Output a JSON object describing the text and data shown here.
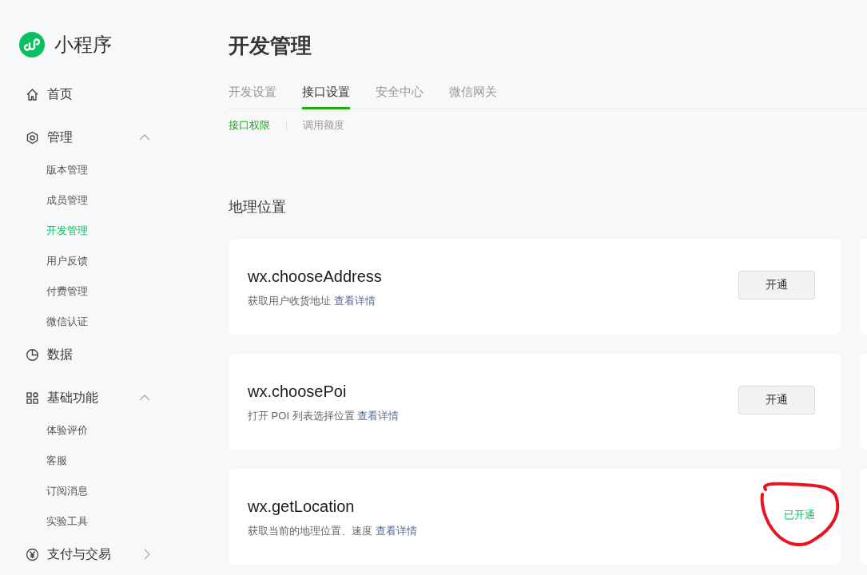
{
  "sidebar": {
    "logo_text": "小程序",
    "items": [
      {
        "label": "首页",
        "kind": "link"
      },
      {
        "label": "管理",
        "kind": "group",
        "expanded": true,
        "children": [
          {
            "label": "版本管理",
            "selected": false
          },
          {
            "label": "成员管理",
            "selected": false
          },
          {
            "label": "开发管理",
            "selected": true
          },
          {
            "label": "用户反馈",
            "selected": false
          },
          {
            "label": "付费管理",
            "selected": false
          },
          {
            "label": "微信认证",
            "selected": false
          }
        ]
      },
      {
        "label": "数据",
        "kind": "link"
      },
      {
        "label": "基础功能",
        "kind": "group",
        "expanded": true,
        "children": [
          {
            "label": "体验评价",
            "selected": false
          },
          {
            "label": "客服",
            "selected": false
          },
          {
            "label": "订阅消息",
            "selected": false
          },
          {
            "label": "实验工具",
            "selected": false
          }
        ]
      },
      {
        "label": "支付与交易",
        "kind": "group",
        "expanded": false
      }
    ]
  },
  "page_title": "开发管理",
  "tabs": [
    {
      "label": "开发设置",
      "selected": false
    },
    {
      "label": "接口设置",
      "selected": true
    },
    {
      "label": "安全中心",
      "selected": false
    },
    {
      "label": "微信网关",
      "selected": false
    }
  ],
  "subtabs": [
    {
      "label": "接口权限",
      "selected": true
    },
    {
      "label": "调用额度",
      "selected": false
    }
  ],
  "section_title": "地理位置",
  "apis": [
    {
      "name": "wx.chooseAddress",
      "description": "获取用户收货地址",
      "link": "查看详情",
      "kind": "button",
      "action": "开通",
      "circled": false
    },
    {
      "name": "wx.choosePoi",
      "description": "打开 POI 列表选择位置",
      "link": "查看详情",
      "kind": "button",
      "action": "开通",
      "circled": false
    },
    {
      "name": "wx.getLocation",
      "description": "获取当前的地理位置、速度",
      "link": "查看详情",
      "kind": "status",
      "action": "已开通",
      "circled": true
    }
  ]
}
